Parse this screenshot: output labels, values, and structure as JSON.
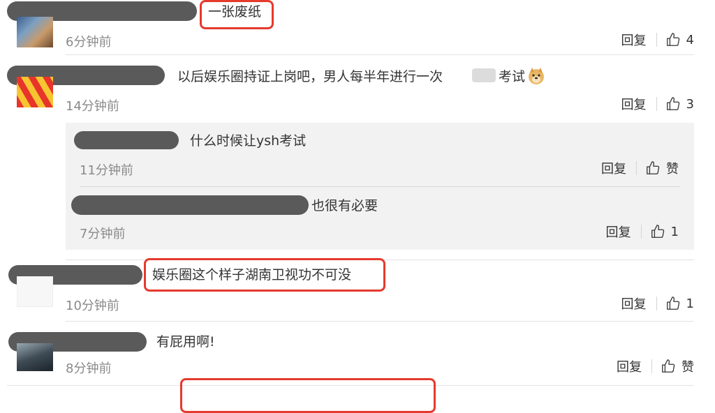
{
  "comments": [
    {
      "text": "一张废纸",
      "time": "6分钟前",
      "reply_label": "回复",
      "like_count": "4"
    },
    {
      "text": "以后娱乐圈持证上岗吧，男人每半年进行一次",
      "text_tail": "考试",
      "time": "14分钟前",
      "reply_label": "回复",
      "like_count": "3"
    },
    {
      "text": "娱乐圈这个样子湖南卫视功不可没",
      "time": "10分钟前",
      "reply_label": "回复",
      "like_count": "1"
    },
    {
      "text": "有屁用啊!",
      "time": "8分钟前",
      "reply_label": "回复",
      "like_count": "赞"
    }
  ],
  "replies": [
    {
      "text": "什么时候让ysh考试",
      "time": "11分钟前",
      "reply_label": "回复",
      "like_count": "赞"
    },
    {
      "text": "也很有必要",
      "time": "7分钟前",
      "reply_label": "回复",
      "like_count": "1"
    }
  ],
  "colors": {
    "highlight": "#e53a2d",
    "redaction": "#5a5a5a",
    "reply_bg": "#f2f2f2"
  },
  "icons": {
    "like": "thumbs-up-icon",
    "emoji": "doge-emoji-icon"
  }
}
